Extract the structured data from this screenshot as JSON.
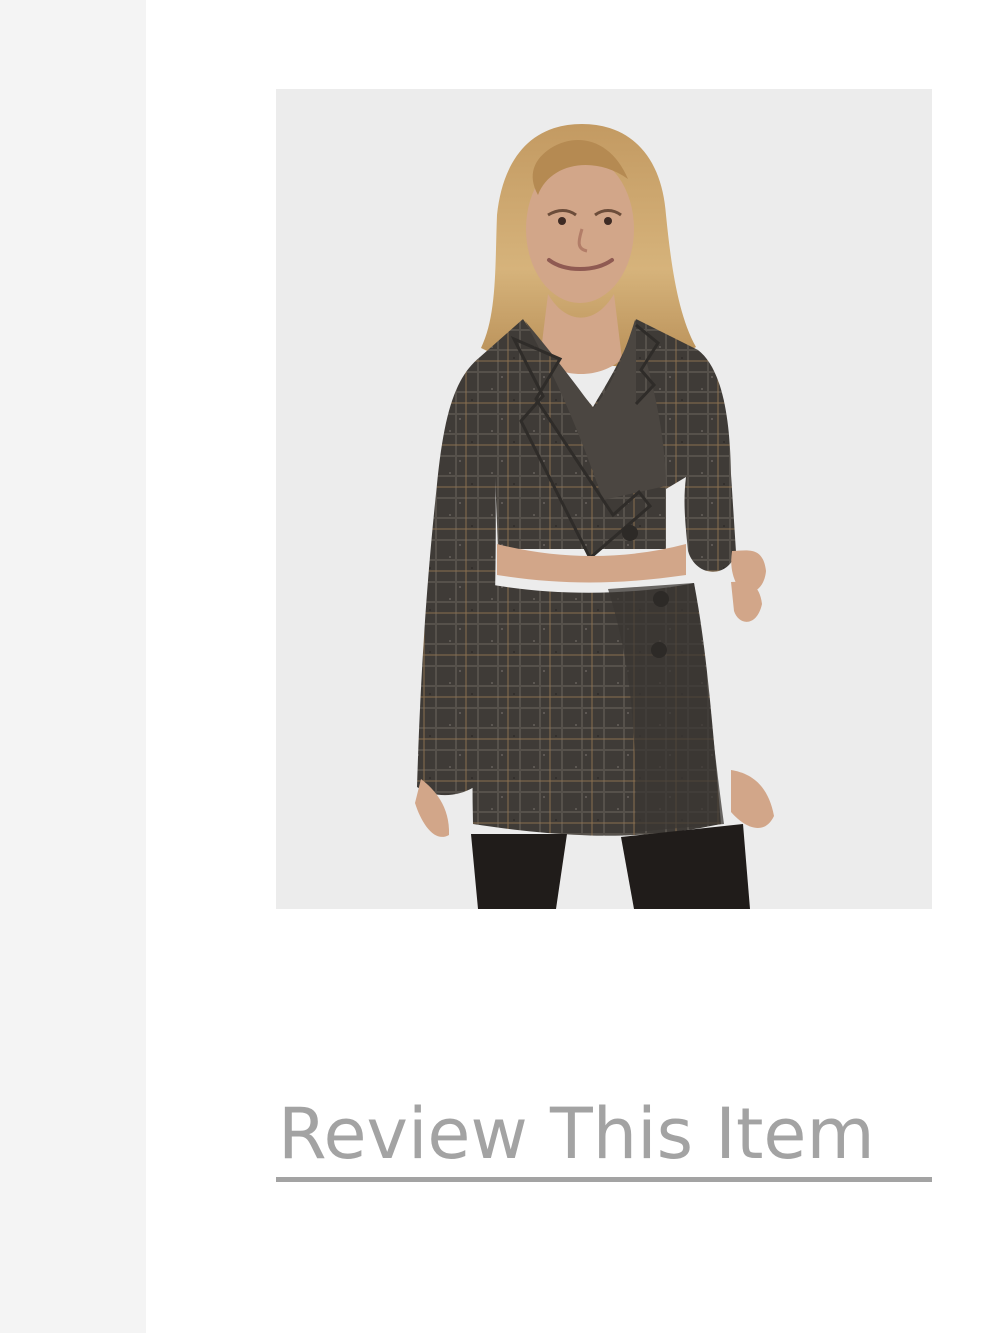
{
  "product": {
    "image_alt": "Woman wearing a grey plaid cropped double-breasted blazer with matching wrap mini skirt and black sheer tights",
    "background_color": "#ececec"
  },
  "review": {
    "link_label": "Review This Item",
    "color": "#a3a3a3"
  }
}
